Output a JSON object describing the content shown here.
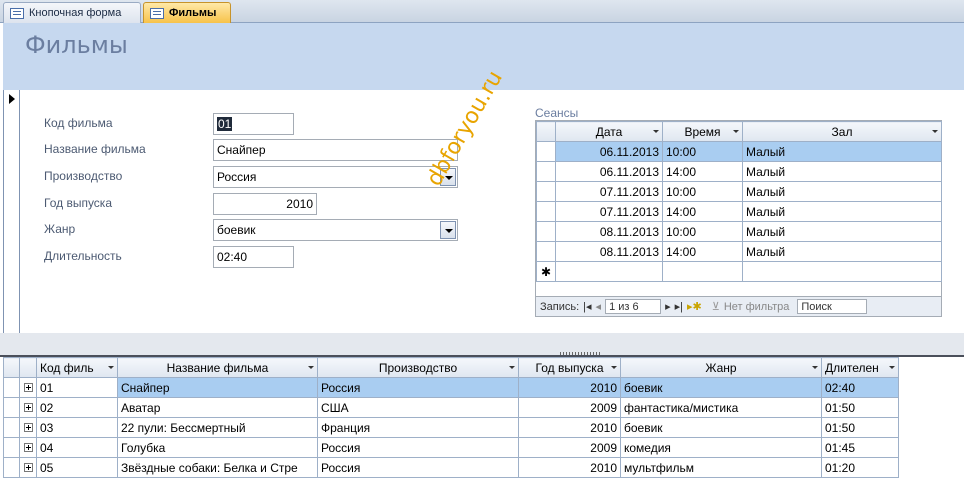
{
  "tabs": [
    {
      "label": "Кнопочная форма"
    },
    {
      "label": "Фильмы"
    }
  ],
  "form": {
    "title": "Фильмы",
    "fields": {
      "code": {
        "label": "Код фильма",
        "value": "01"
      },
      "name": {
        "label": "Название фильма",
        "value": "Снайпер"
      },
      "production": {
        "label": "Производство",
        "value": "Россия"
      },
      "year": {
        "label": "Год выпуска",
        "value": "2010"
      },
      "genre": {
        "label": "Жанр",
        "value": "боевик"
      },
      "duration": {
        "label": "Длительность",
        "value": "02:40"
      }
    }
  },
  "sessions": {
    "label": "Сеансы",
    "columns": [
      "Дата",
      "Время",
      "Зал"
    ],
    "rows": [
      [
        "06.11.2013",
        "10:00",
        "Малый"
      ],
      [
        "06.11.2013",
        "14:00",
        "Малый"
      ],
      [
        "07.11.2013",
        "10:00",
        "Малый"
      ],
      [
        "07.11.2013",
        "14:00",
        "Малый"
      ],
      [
        "08.11.2013",
        "10:00",
        "Малый"
      ],
      [
        "08.11.2013",
        "14:00",
        "Малый"
      ]
    ],
    "new_row_marker": "✱",
    "nav": {
      "record_label": "Запись:",
      "position": "1 из 6",
      "filter": "Нет фильтра",
      "search": "Поиск"
    }
  },
  "watermark": "dbforyou.ru",
  "films": {
    "columns": [
      "Код филь",
      "Название фильма",
      "Производство",
      "Год выпуска",
      "Жанр",
      "Длителен"
    ],
    "rows": [
      [
        "01",
        "Снайпер",
        "Россия",
        "2010",
        "боевик",
        "02:40"
      ],
      [
        "02",
        "Аватар",
        "США",
        "2009",
        "фантастика/мистика",
        "01:50"
      ],
      [
        "03",
        "22 пули: Бессмертный",
        "Франция",
        "2010",
        "боевик",
        "01:50"
      ],
      [
        "04",
        "Голубка",
        "Россия",
        "2009",
        "комедия",
        "01:45"
      ],
      [
        "05",
        "Звёздные собаки: Белка и Стре",
        "Россия",
        "2010",
        "мультфильм",
        "01:20"
      ]
    ]
  },
  "colors": {
    "header_bg": "#c6d8ef",
    "selection": "#a9cdf1",
    "active_tab": "#f7c24a",
    "watermark": "#e8a400"
  }
}
